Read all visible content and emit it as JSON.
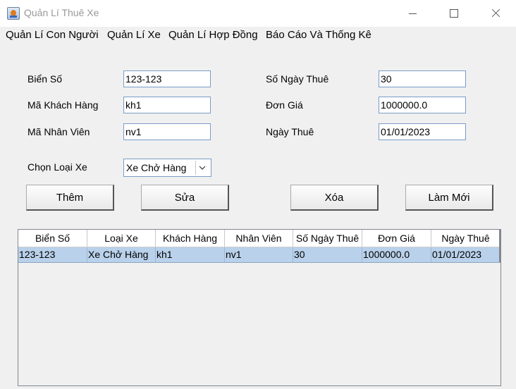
{
  "window": {
    "title": "Quản Lí Thuê Xe"
  },
  "menu": [
    "Quản Lí Con Người",
    "Quản Lí Xe",
    "Quản Lí Hợp Đồng",
    "Báo Cáo Và Thống Kê"
  ],
  "form": {
    "bien_so": {
      "label": "Biển Số",
      "value": "123-123"
    },
    "ma_khach_hang": {
      "label": "Mã Khách Hàng",
      "value": "kh1"
    },
    "ma_nhan_vien": {
      "label": "Mã Nhân Viên",
      "value": "nv1"
    },
    "so_ngay_thue": {
      "label": "Số Ngày Thuê",
      "value": "30"
    },
    "don_gia": {
      "label": "Đơn Giá",
      "value": "1000000.0"
    },
    "ngay_thue": {
      "label": "Ngày Thuê",
      "value": "01/01/2023"
    },
    "loai_xe": {
      "label": "Chọn Loại Xe",
      "selected": "Xe Chở Hàng"
    }
  },
  "buttons": {
    "add": "Thêm",
    "edit": "Sửa",
    "delete": "Xóa",
    "refresh": "Làm Mới"
  },
  "table": {
    "columns": [
      "Biển Số",
      "Loại Xe",
      "Khách Hàng",
      "Nhân Viên",
      "Số Ngày Thuê",
      "Đơn Giá",
      "Ngày Thuê"
    ],
    "rows": [
      [
        "123-123",
        "Xe Chở Hàng",
        "kh1",
        "nv1",
        "30",
        "1000000.0",
        "01/01/2023"
      ]
    ]
  },
  "colors": {
    "selection": "#b9d1ea",
    "field_border": "#7a9cc7",
    "background": "#f0f0f0"
  }
}
